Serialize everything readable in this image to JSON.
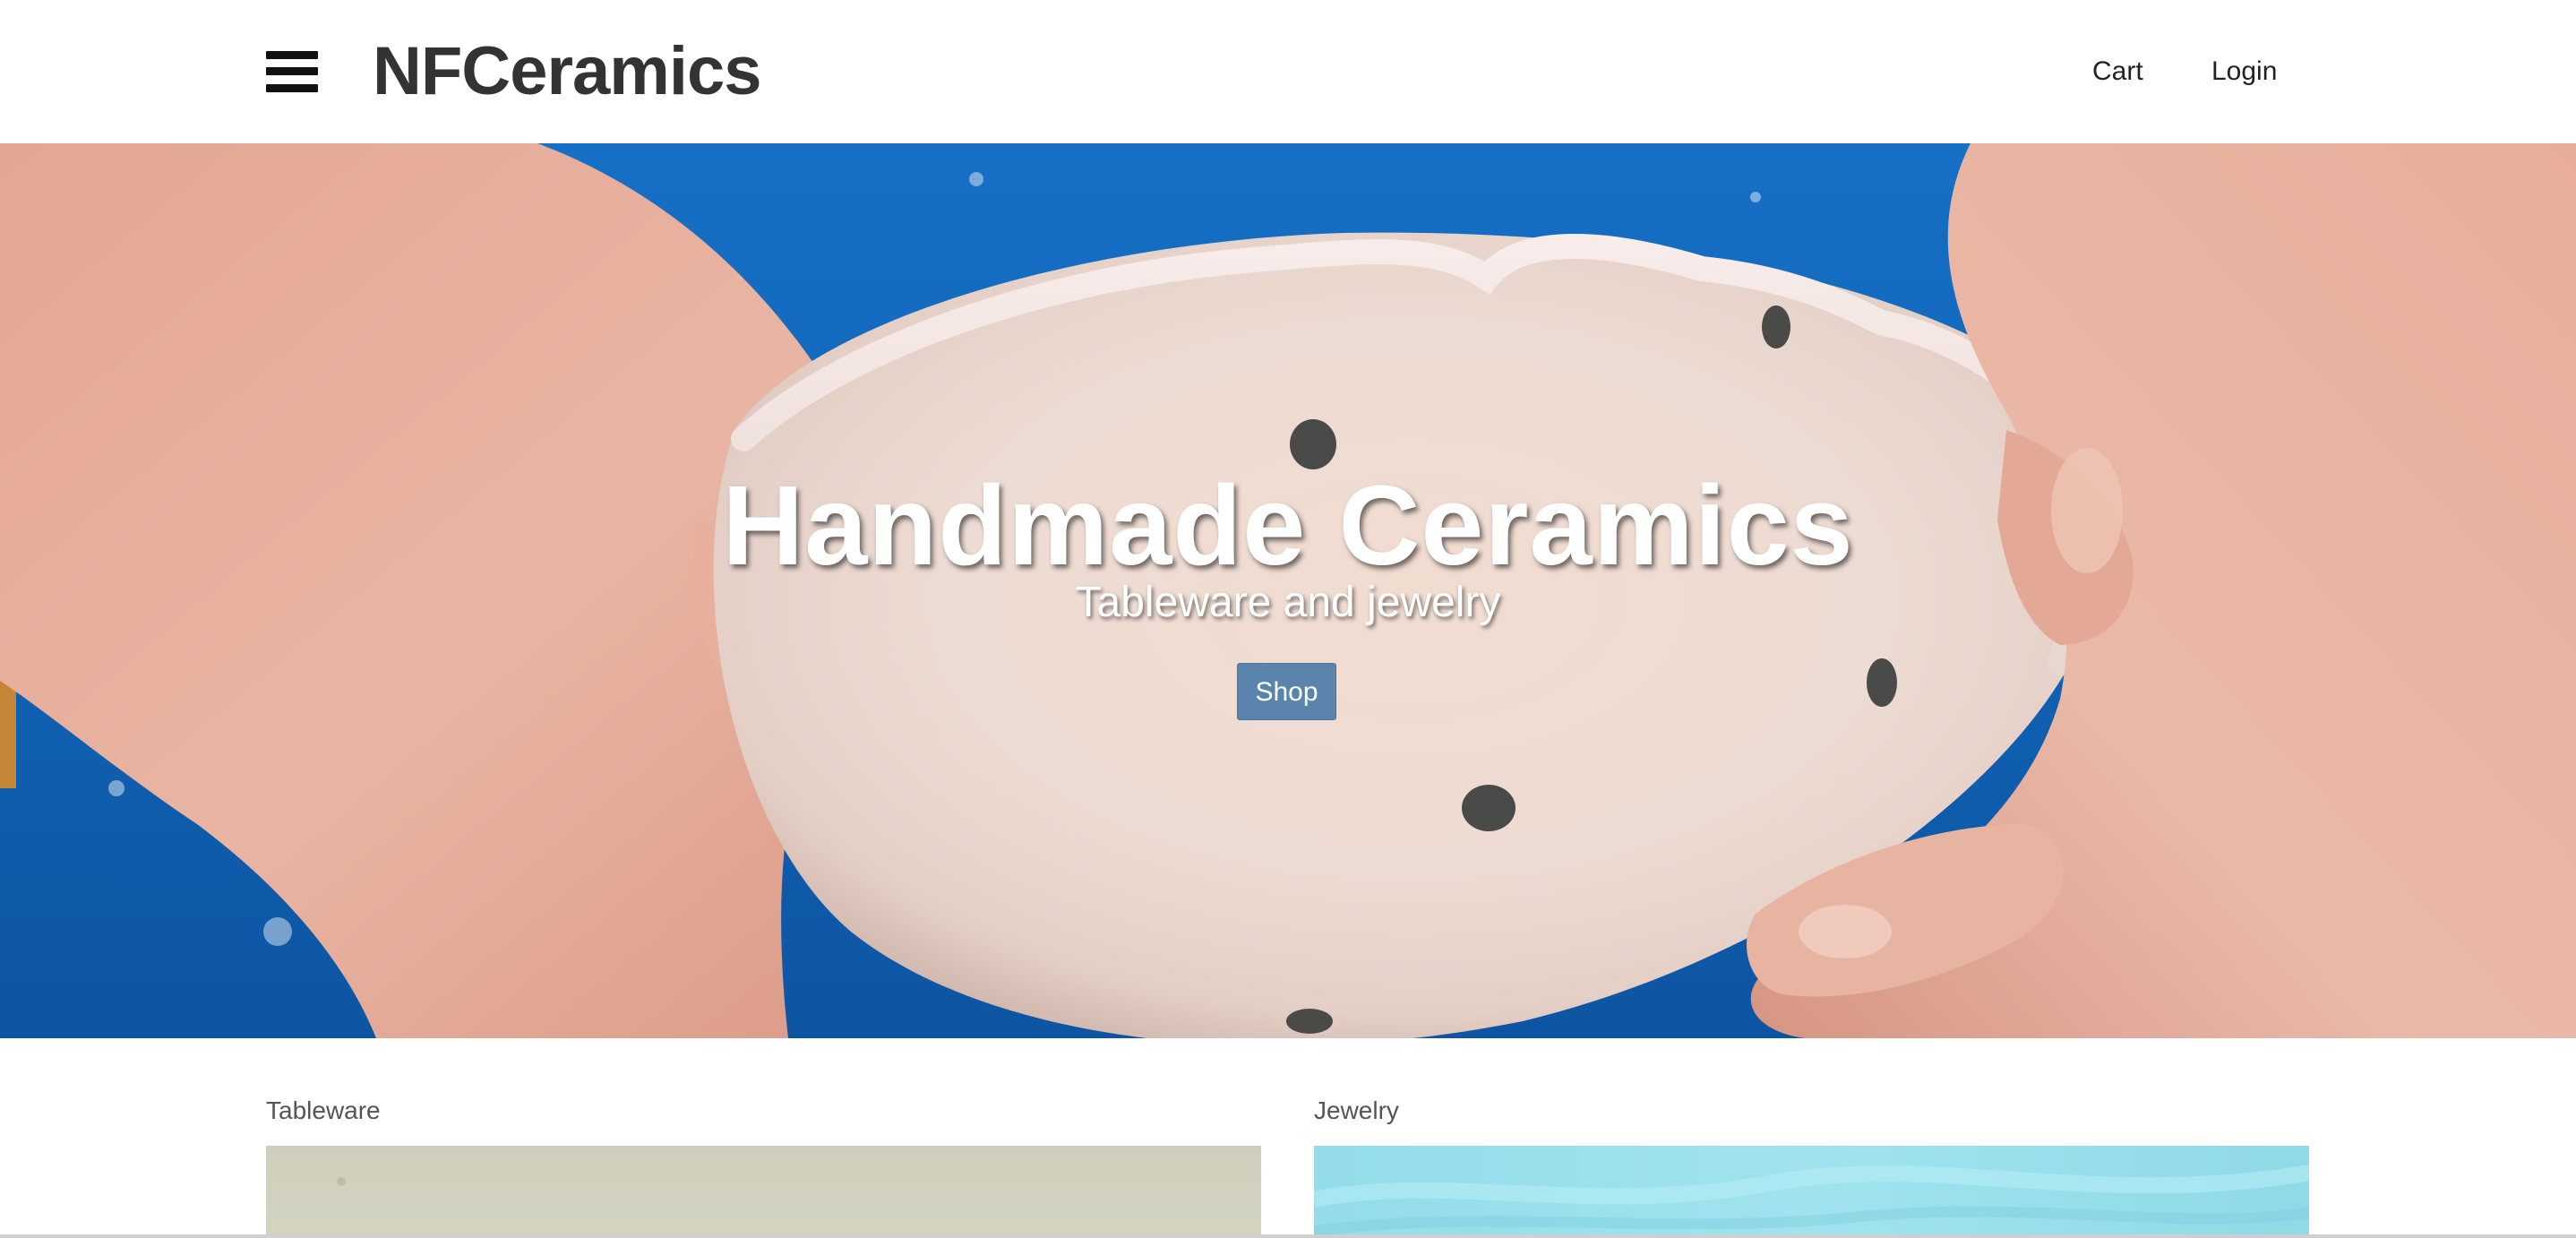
{
  "header": {
    "brand": "NFCeramics",
    "menu_icon": "hamburger-menu-icon",
    "nav": {
      "cart": "Cart",
      "login": "Login"
    }
  },
  "hero": {
    "title": "Handmade Ceramics",
    "subtitle": "Tableware and jewelry",
    "button_label": "Shop",
    "image": "hands-holding-white-ceramic-bowl-image"
  },
  "categories": [
    {
      "label": "Tableware",
      "image": "tableware-category-image"
    },
    {
      "label": "Jewelry",
      "image": "jewelry-category-image"
    }
  ],
  "colors": {
    "button": "#5b84ad",
    "text": "#333333",
    "apron_blue": "#1466b8"
  }
}
